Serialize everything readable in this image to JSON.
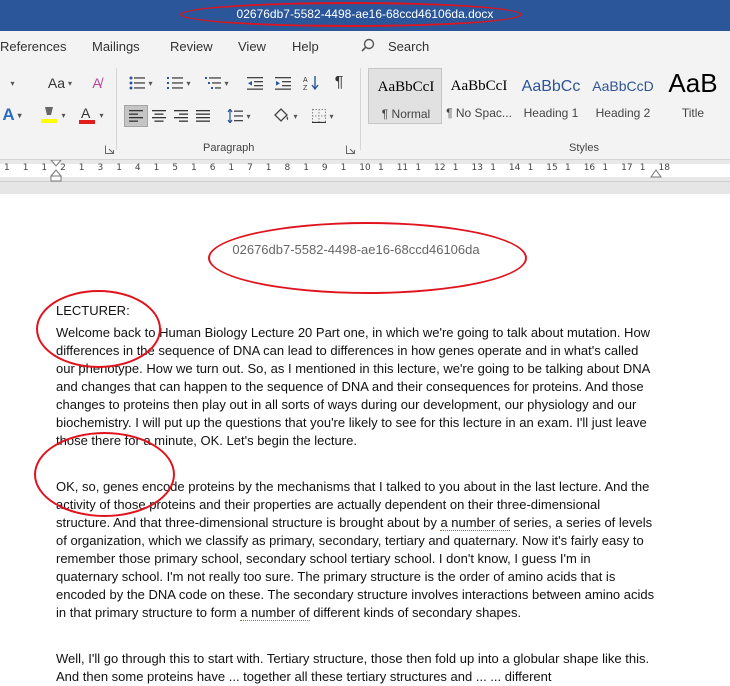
{
  "window": {
    "title": "02676db7-5582-4498-ae16-68ccd46106da.docx"
  },
  "menu": {
    "tabs": [
      "References",
      "Mailings",
      "Review",
      "View",
      "Help"
    ],
    "search_label": "Search"
  },
  "ribbon": {
    "font_size_glyph": "Aa",
    "paragraph_label": "Paragraph",
    "styles_label": "Styles",
    "styles": [
      {
        "sample": "AaBbCcI",
        "name": "¶ Normal"
      },
      {
        "sample": "AaBbCcI",
        "name": "¶ No Spac..."
      },
      {
        "sample": "AaBbCc",
        "name": "Heading 1"
      },
      {
        "sample": "AaBbCcD",
        "name": "Heading 2"
      },
      {
        "sample": "AaB",
        "name": "Title"
      }
    ]
  },
  "ruler": {
    "numbers": [
      "1",
      "1",
      "1",
      "2",
      "1",
      "3",
      "1",
      "4",
      "1",
      "5",
      "1",
      "6",
      "1",
      "7",
      "1",
      "8",
      "1",
      "9",
      "1",
      "10",
      "1",
      "11",
      "1",
      "12",
      "1",
      "13",
      "1",
      "14",
      "1",
      "15",
      "1",
      "16",
      "1",
      "17",
      "1",
      "18"
    ]
  },
  "document": {
    "heading": "02676db7-5582-4498-ae16-68ccd46106da",
    "speaker": "LECTURER:",
    "paragraphs": [
      "Welcome back to Human Biology Lecture 20 Part one, in which we're going to talk about mutation. How differences in the sequence of DNA can lead to differences in how genes operate and in what's called our phenotype. How we turn out. So, as I mentioned in this lecture, we're going to be talking about DNA and changes that can happen to the sequence of DNA and their consequences for proteins. And those changes to proteins then play out in all sorts of ways during our development, our physiology and our biochemistry. I will put up the questions that you're likely to see for this lecture in an exam. I'll just leave those there for a minute, OK. Let's begin the lecture.",
      "OK, so, genes encode proteins by the mechanisms that I talked to you about in the last lecture. And the activity of those proteins and their properties are actually dependent on their three-dimensional structure. And that three-dimensional structure is brought about by a number of series, a series of levels of organization, which we classify as primary, secondary, tertiary and quaternary. Now it's fairly easy to remember those primary school, secondary school tertiary school. I don't know, I guess I'm in quaternary school. I'm not really too sure. The primary structure is the order of amino acids that is encoded by the DNA code on these. The secondary structure involves interactions between amino acids in that primary structure to form a number of different kinds of secondary shapes.",
      "Well, I'll go through this to start with. Tertiary structure, those then fold up into a globular shape like this. And then some proteins have ... together all these tertiary structures and ... ... different"
    ]
  }
}
